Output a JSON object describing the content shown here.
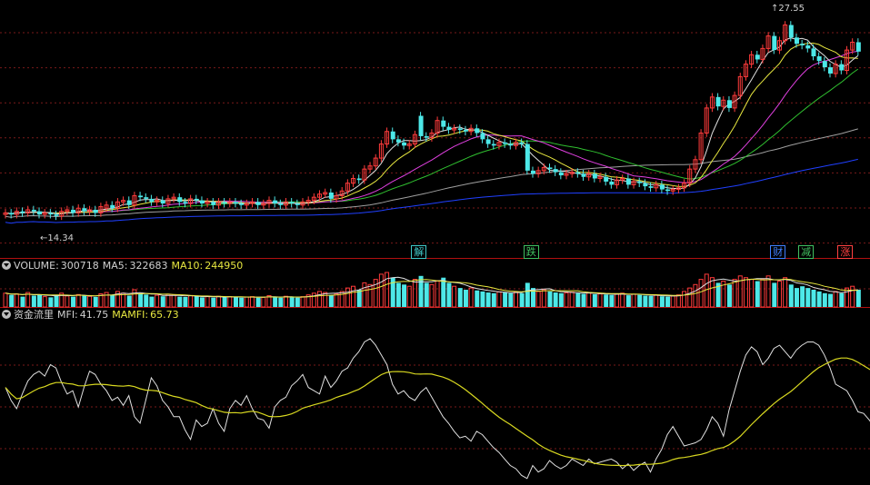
{
  "colors": {
    "up": "#ff3b3b",
    "down": "#4de8e8",
    "ma_white": "#e0e0e0",
    "ma_yellow": "#e8e840",
    "ma_magenta": "#e040e0",
    "ma_green": "#30c030",
    "ma_gray": "#a0a0a0",
    "ma_blue": "#2040ff",
    "grid": "#7a1a1a",
    "mfi": "#e0e0e0",
    "mamfi": "#d8d820"
  },
  "price_panel": {
    "high_label": "27.55",
    "low_label": "14.34",
    "badges": [
      {
        "text": "解",
        "color": "#40c8c8",
        "bar": 73
      },
      {
        "text": "跌",
        "color": "#40c060",
        "bar": 93
      },
      {
        "text": "财",
        "color": "#4080ff",
        "bar": 137
      },
      {
        "text": "减",
        "color": "#40c060",
        "bar": 142
      },
      {
        "text": "涨",
        "color": "#ff4040",
        "bar": 149
      }
    ]
  },
  "volume_panel": {
    "name": "VOLUME:",
    "value": "300718",
    "ma5_label": "MA5:",
    "ma5_value": "322683",
    "ma10_label": "MA10:",
    "ma10_value": "244950"
  },
  "mfi_panel": {
    "name": "资金流里",
    "mfi_label": "MFI:",
    "mfi_value": "41.75",
    "mamfi_label": "MAMFI:",
    "mamfi_value": "65.73"
  },
  "chart_data": {
    "type": "candlestick",
    "note_source": "values estimated from screenshot",
    "price_range": [
      13.5,
      28.0
    ],
    "closes": [
      15.1,
      15.0,
      15.2,
      15.1,
      15.3,
      15.2,
      15.0,
      15.1,
      15.0,
      14.9,
      15.2,
      15.3,
      15.1,
      15.4,
      15.2,
      15.3,
      15.1,
      15.5,
      15.6,
      15.4,
      15.8,
      15.9,
      15.6,
      16.2,
      16.1,
      16.0,
      15.8,
      15.9,
      15.7,
      16.0,
      16.1,
      15.8,
      15.7,
      16.0,
      15.9,
      15.7,
      15.8,
      15.6,
      15.8,
      15.7,
      15.8,
      15.7,
      15.6,
      15.7,
      15.8,
      15.6,
      15.7,
      15.9,
      15.7,
      15.6,
      15.8,
      15.7,
      15.6,
      15.8,
      15.9,
      16.1,
      16.3,
      16.4,
      16.0,
      16.2,
      16.5,
      17.0,
      17.3,
      17.2,
      17.9,
      18.1,
      18.6,
      19.5,
      20.3,
      19.8,
      19.6,
      19.4,
      19.5,
      20.1,
      20.0,
      19.9,
      20.2,
      21.0,
      20.6,
      20.4,
      20.5,
      20.4,
      20.3,
      20.5,
      20.2,
      19.8,
      19.5,
      19.4,
      19.6,
      19.5,
      19.4,
      19.6,
      19.5,
      17.8,
      17.6,
      17.8,
      18.0,
      17.9,
      17.7,
      17.5,
      17.6,
      17.7,
      17.6,
      17.4,
      17.6,
      17.3,
      17.4,
      17.1,
      16.9,
      17.2,
      17.3,
      16.9,
      17.1,
      17.0,
      16.8,
      16.7,
      16.9,
      16.6,
      16.5,
      16.6,
      16.7,
      17.0,
      17.9,
      18.5,
      20.2,
      21.8,
      22.5,
      21.9,
      22.3,
      21.8,
      22.6,
      23.8,
      24.6,
      25.2,
      24.9,
      25.6,
      26.4,
      25.5,
      26.1,
      27.1,
      26.3,
      25.9,
      25.8,
      25.6,
      25.1,
      24.8,
      24.4,
      24.0,
      24.6,
      24.2,
      25.5,
      26.0,
      25.4
    ],
    "opens": [
      15.0,
      15.1,
      15.0,
      15.2,
      15.1,
      15.3,
      15.2,
      15.0,
      15.1,
      15.0,
      14.9,
      15.2,
      15.3,
      15.1,
      15.4,
      15.2,
      15.3,
      15.1,
      15.4,
      15.6,
      15.4,
      15.8,
      15.9,
      15.6,
      16.2,
      16.1,
      16.0,
      15.8,
      15.9,
      15.7,
      16.0,
      16.1,
      15.8,
      15.7,
      16.0,
      15.9,
      15.7,
      15.8,
      15.6,
      15.8,
      15.7,
      15.8,
      15.7,
      15.6,
      15.7,
      15.8,
      15.6,
      15.7,
      15.9,
      15.7,
      15.6,
      15.8,
      15.7,
      15.6,
      15.8,
      15.9,
      16.1,
      16.3,
      16.4,
      16.0,
      16.2,
      16.5,
      17.0,
      17.3,
      17.2,
      17.9,
      18.1,
      18.6,
      19.5,
      20.3,
      19.8,
      19.6,
      19.4,
      19.5,
      21.3,
      20.0,
      19.9,
      20.2,
      21.0,
      20.6,
      20.4,
      20.5,
      20.4,
      20.3,
      20.5,
      20.2,
      19.8,
      19.5,
      19.4,
      19.6,
      19.5,
      19.4,
      19.6,
      19.5,
      17.8,
      17.6,
      17.8,
      18.0,
      17.9,
      17.7,
      17.5,
      17.6,
      17.7,
      17.6,
      17.4,
      17.6,
      17.3,
      17.4,
      17.1,
      16.9,
      17.2,
      17.3,
      16.9,
      17.1,
      17.0,
      16.8,
      16.7,
      16.9,
      16.6,
      16.5,
      16.6,
      16.7,
      17.0,
      17.9,
      18.5,
      20.2,
      21.8,
      22.5,
      21.9,
      22.3,
      21.8,
      22.6,
      23.8,
      24.6,
      25.2,
      24.9,
      25.6,
      26.4,
      25.5,
      26.1,
      27.1,
      26.3,
      25.9,
      25.8,
      25.6,
      25.1,
      24.8,
      24.4,
      24.0,
      24.6,
      24.2,
      25.5,
      26.0
    ],
    "volumes": [
      0.4,
      0.35,
      0.38,
      0.3,
      0.42,
      0.33,
      0.36,
      0.3,
      0.28,
      0.35,
      0.4,
      0.32,
      0.3,
      0.36,
      0.33,
      0.31,
      0.29,
      0.38,
      0.42,
      0.35,
      0.45,
      0.4,
      0.33,
      0.5,
      0.38,
      0.36,
      0.3,
      0.34,
      0.31,
      0.37,
      0.35,
      0.3,
      0.29,
      0.33,
      0.31,
      0.28,
      0.3,
      0.27,
      0.31,
      0.29,
      0.3,
      0.28,
      0.27,
      0.29,
      0.3,
      0.27,
      0.28,
      0.33,
      0.29,
      0.27,
      0.31,
      0.28,
      0.27,
      0.3,
      0.35,
      0.4,
      0.45,
      0.42,
      0.35,
      0.38,
      0.45,
      0.55,
      0.6,
      0.5,
      0.7,
      0.65,
      0.8,
      0.95,
      1.0,
      0.85,
      0.7,
      0.65,
      0.6,
      0.8,
      0.9,
      0.7,
      0.65,
      0.75,
      0.85,
      0.7,
      0.6,
      0.55,
      0.5,
      0.55,
      0.48,
      0.45,
      0.42,
      0.4,
      0.44,
      0.42,
      0.4,
      0.43,
      0.4,
      0.7,
      0.55,
      0.45,
      0.5,
      0.45,
      0.42,
      0.4,
      0.41,
      0.43,
      0.4,
      0.38,
      0.41,
      0.37,
      0.38,
      0.36,
      0.35,
      0.38,
      0.4,
      0.34,
      0.37,
      0.35,
      0.33,
      0.32,
      0.34,
      0.31,
      0.3,
      0.32,
      0.35,
      0.45,
      0.55,
      0.65,
      0.8,
      0.95,
      0.85,
      0.7,
      0.75,
      0.65,
      0.8,
      0.9,
      0.85,
      0.8,
      0.75,
      0.8,
      0.9,
      0.7,
      0.75,
      0.85,
      0.65,
      0.55,
      0.6,
      0.55,
      0.5,
      0.45,
      0.4,
      0.38,
      0.45,
      0.4,
      0.55,
      0.6,
      0.5
    ],
    "mfi": [
      60,
      52,
      47,
      56,
      64,
      68,
      70,
      67,
      74,
      72,
      63,
      56,
      58,
      48,
      60,
      70,
      68,
      62,
      58,
      52,
      54,
      49,
      55,
      42,
      38,
      52,
      66,
      61,
      52,
      48,
      42,
      42,
      34,
      28,
      40,
      36,
      38,
      47,
      38,
      33,
      47,
      52,
      49,
      55,
      47,
      41,
      40,
      35,
      48,
      52,
      54,
      61,
      64,
      68,
      60,
      58,
      56,
      67,
      60,
      64,
      70,
      72,
      78,
      82,
      88,
      90,
      86,
      80,
      74,
      62,
      56,
      58,
      54,
      52,
      57,
      60,
      54,
      48,
      42,
      38,
      33,
      29,
      30,
      27,
      33,
      31,
      27,
      23,
      20,
      16,
      12,
      10,
      6,
      4,
      12,
      8,
      10,
      15,
      12,
      10,
      12,
      16,
      14,
      12,
      16,
      13,
      14,
      15,
      16,
      14,
      10,
      13,
      9,
      12,
      14,
      8,
      16,
      22,
      31,
      36,
      30,
      24,
      25,
      26,
      28,
      34,
      42,
      38,
      30,
      46,
      58,
      70,
      80,
      85,
      82,
      74,
      78,
      84,
      86,
      82,
      78,
      83,
      86,
      88,
      88,
      86,
      80,
      72,
      62,
      60,
      58,
      52,
      45,
      44,
      40,
      35,
      28,
      19,
      17,
      17,
      21
    ]
  }
}
